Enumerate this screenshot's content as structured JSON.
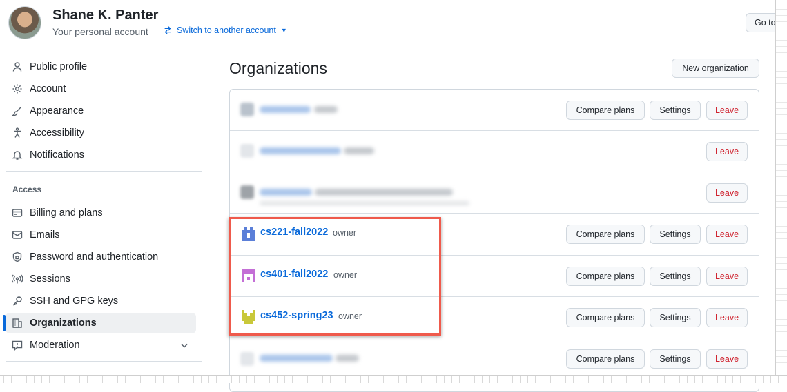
{
  "header": {
    "user_name": "Shane K. Panter",
    "subtitle": "Your personal account",
    "switch_label": "Switch to another account",
    "goto_label": "Go to"
  },
  "sidebar": {
    "items": [
      {
        "label": "Public profile",
        "icon": "person-icon"
      },
      {
        "label": "Account",
        "icon": "gear-icon"
      },
      {
        "label": "Appearance",
        "icon": "paintbrush-icon"
      },
      {
        "label": "Accessibility",
        "icon": "accessibility-icon"
      },
      {
        "label": "Notifications",
        "icon": "bell-icon"
      }
    ],
    "access_heading": "Access",
    "access_items": [
      {
        "label": "Billing and plans",
        "icon": "credit-card-icon"
      },
      {
        "label": "Emails",
        "icon": "mail-icon"
      },
      {
        "label": "Password and authentication",
        "icon": "shield-lock-icon"
      },
      {
        "label": "Sessions",
        "icon": "broadcast-icon"
      },
      {
        "label": "SSH and GPG keys",
        "icon": "key-icon"
      },
      {
        "label": "Organizations",
        "icon": "organization-icon",
        "active": true
      },
      {
        "label": "Moderation",
        "icon": "report-icon",
        "expandable": true
      }
    ]
  },
  "main": {
    "title": "Organizations",
    "new_org_label": "New organization",
    "buttons": {
      "compare": "Compare plans",
      "settings": "Settings",
      "leave": "Leave"
    },
    "orgs": [
      {
        "name": "cs221-fall2022",
        "role": "owner"
      },
      {
        "name": "cs401-fall2022",
        "role": "owner"
      },
      {
        "name": "cs452-spring23",
        "role": "owner"
      }
    ]
  },
  "colors": {
    "link": "#0969da",
    "danger": "#cf222e",
    "highlight": "#ef5a4c",
    "active_bar": "#0969da"
  }
}
